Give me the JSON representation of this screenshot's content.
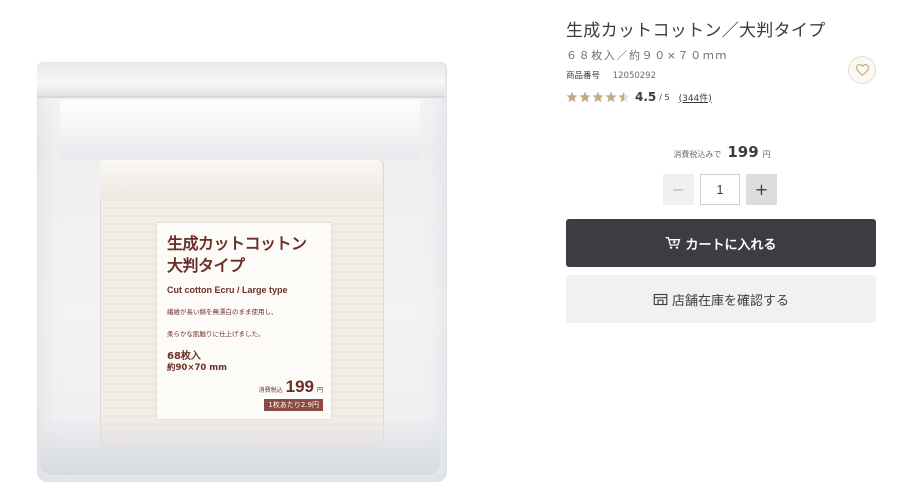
{
  "product": {
    "title": "生成カットコットン／大判タイプ",
    "spec": "６８枚入／約９０×７０ｍｍ",
    "code_label": "商品番号",
    "code": "12050292",
    "rating": "4.5",
    "rating_max": "/ 5",
    "rating_fraction": 0.9,
    "reviews": "(344件)",
    "price_prefix": "消費税込みで",
    "price": "199",
    "price_unit": "円"
  },
  "quantity": {
    "value": "1",
    "minus": "−",
    "plus": "+"
  },
  "actions": {
    "cart": "カートに入れる",
    "store": "店舗在庫を確認する"
  },
  "package_label": {
    "title_line1": "生成カットコットン",
    "title_line2": "大判タイプ",
    "english": "Cut cotton Ecru / Large type",
    "desc_line1": "繊維が長い綿を無漂白のまま使用し、",
    "desc_line2": "柔らかな肌触りに仕上げました。",
    "count": "68枚入",
    "size": "約90×70 mm",
    "price_prefix": "消費税込",
    "price": "199",
    "price_unit": "円",
    "per_sheet": "1枚あたり2.9円"
  },
  "colors": {
    "accent_dark": "#3c3c43",
    "star": "#c3aa84",
    "label_text": "#6b2f28"
  },
  "icons": {
    "favorite": "heart-icon",
    "cart": "cart-icon",
    "store": "store-icon"
  }
}
